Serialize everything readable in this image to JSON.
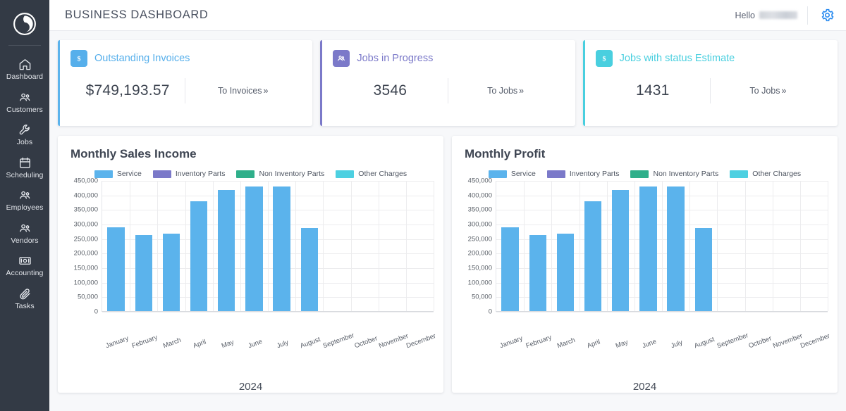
{
  "sidebar": {
    "logo_icon": "swirl-logo-icon",
    "items": [
      {
        "label": "Dashboard",
        "icon": "home-icon"
      },
      {
        "label": "Customers",
        "icon": "people-icon"
      },
      {
        "label": "Jobs",
        "icon": "wrench-icon"
      },
      {
        "label": "Scheduling",
        "icon": "calendar-icon"
      },
      {
        "label": "Employees",
        "icon": "people-icon"
      },
      {
        "label": "Vendors",
        "icon": "people-icon"
      },
      {
        "label": "Accounting",
        "icon": "money-icon"
      },
      {
        "label": "Tasks",
        "icon": "paperclip-icon"
      }
    ]
  },
  "header": {
    "title": "BUSINESS DASHBOARD",
    "greeting": "Hello",
    "username": "",
    "settings_icon": "gear-icon"
  },
  "kpis": [
    {
      "title": "Outstanding Invoices",
      "value": "$749,193.57",
      "link": "To Invoices",
      "chevron": "»",
      "icon": "dollar-icon",
      "color": "#56AFEB"
    },
    {
      "title": "Jobs in Progress",
      "value": "3546",
      "link": "To Jobs",
      "chevron": "»",
      "icon": "people-icon",
      "color": "#7B79C9"
    },
    {
      "title": "Jobs with status Estimate",
      "value": "1431",
      "link": "To Jobs",
      "chevron": "»",
      "icon": "dollar-icon",
      "color": "#49CFDF"
    }
  ],
  "chart_data": [
    {
      "type": "bar",
      "title": "Monthly Sales Income",
      "xlabel": "2024",
      "ylabel": "",
      "categories": [
        "January",
        "February",
        "March",
        "April",
        "May",
        "June",
        "July",
        "August",
        "September",
        "October",
        "November",
        "December"
      ],
      "series": [
        {
          "name": "Service",
          "color": "#5BB3EC",
          "values": [
            288000,
            262000,
            265000,
            378000,
            417000,
            428000,
            428000,
            285000,
            0,
            0,
            0,
            0
          ]
        },
        {
          "name": "Inventory Parts",
          "color": "#7B79C9",
          "values": [
            0,
            0,
            0,
            0,
            0,
            0,
            0,
            0,
            0,
            0,
            0,
            0
          ]
        },
        {
          "name": "Non Inventory Parts",
          "color": "#2FAF8A",
          "values": [
            0,
            0,
            0,
            0,
            0,
            0,
            0,
            0,
            0,
            0,
            0,
            0
          ]
        },
        {
          "name": "Other Charges",
          "color": "#4DD0E1",
          "values": [
            0,
            0,
            0,
            0,
            0,
            0,
            0,
            0,
            0,
            0,
            0,
            0
          ]
        }
      ],
      "yticks": [
        "450,000",
        "400,000",
        "350,000",
        "300,000",
        "250,000",
        "200,000",
        "150,000",
        "100,000",
        "50,000",
        "0"
      ],
      "ylim": [
        0,
        450000
      ],
      "grid": true,
      "legend_position": "top"
    },
    {
      "type": "bar",
      "title": "Monthly Profit",
      "xlabel": "2024",
      "ylabel": "",
      "categories": [
        "January",
        "February",
        "March",
        "April",
        "May",
        "June",
        "July",
        "August",
        "September",
        "October",
        "November",
        "December"
      ],
      "series": [
        {
          "name": "Service",
          "color": "#5BB3EC",
          "values": [
            288000,
            262000,
            265000,
            378000,
            417000,
            428000,
            428000,
            285000,
            0,
            0,
            0,
            0
          ]
        },
        {
          "name": "Inventory Parts",
          "color": "#7B79C9",
          "values": [
            0,
            0,
            0,
            0,
            0,
            0,
            0,
            0,
            0,
            0,
            0,
            0
          ]
        },
        {
          "name": "Non Inventory Parts",
          "color": "#2FAF8A",
          "values": [
            0,
            0,
            0,
            0,
            0,
            0,
            0,
            0,
            0,
            0,
            0,
            0
          ]
        },
        {
          "name": "Other Charges",
          "color": "#4DD0E1",
          "values": [
            0,
            0,
            0,
            0,
            0,
            0,
            0,
            0,
            0,
            0,
            0,
            0
          ]
        }
      ],
      "yticks": [
        "450,000",
        "400,000",
        "350,000",
        "300,000",
        "250,000",
        "200,000",
        "150,000",
        "100,000",
        "50,000",
        "0"
      ],
      "ylim": [
        0,
        450000
      ],
      "grid": true,
      "legend_position": "top"
    }
  ]
}
